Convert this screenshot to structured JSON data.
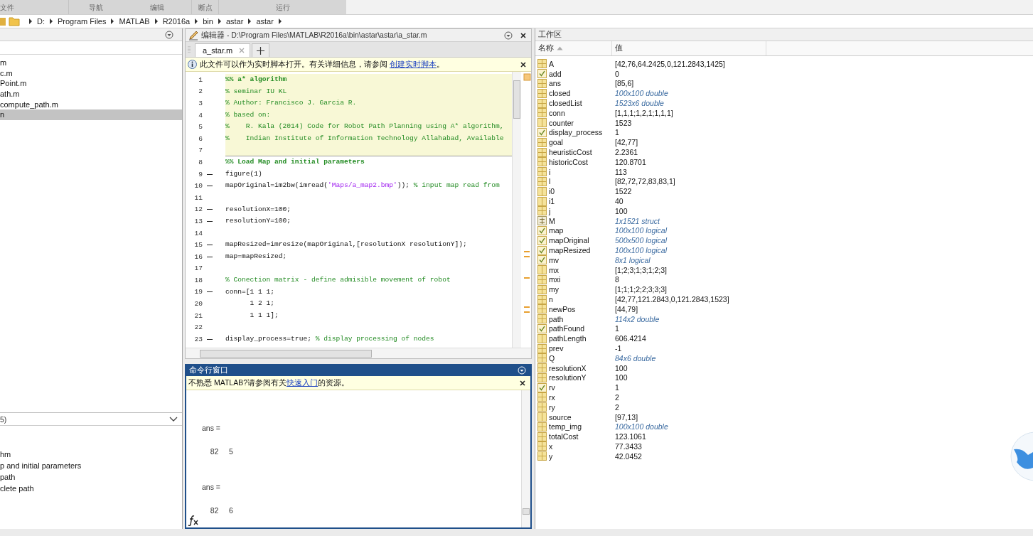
{
  "toolstrip": {
    "sections": [
      {
        "label": "文件"
      },
      {
        "label": "导航"
      },
      {
        "label": "编辑"
      },
      {
        "label": "断点"
      },
      {
        "label": "运行"
      }
    ]
  },
  "address_bar": {
    "segments": [
      "D:",
      "Program Files",
      "MATLAB",
      "R2016a",
      "bin",
      "astar",
      "astar"
    ]
  },
  "current_folder": {
    "files": [
      {
        "name": "m",
        "selected": false
      },
      {
        "name": "c.m",
        "selected": false
      },
      {
        "name": "Point.m",
        "selected": false
      },
      {
        "name": "ath.m",
        "selected": false
      },
      {
        "name": "compute_path.m",
        "selected": false
      },
      {
        "name": "n",
        "selected": true
      }
    ]
  },
  "details": {
    "header": "5)",
    "items": [
      "hm",
      "p and initial parameters",
      " path",
      "clete path"
    ]
  },
  "editor": {
    "title": "编辑器 - D:\\Program Files\\MATLAB\\R2016a\\bin\\astar\\astar\\a_star.m",
    "tabs": [
      {
        "label": "a_star.m",
        "selected": true
      }
    ],
    "info_bar": {
      "text": "此文件可以作为实时脚本打开。有关详细信息，请参阅 ",
      "link": "创建实时脚本",
      "end": "。"
    },
    "lines": [
      {
        "number": "1",
        "dash": false,
        "cell": true,
        "segments": [
          {
            "kind": "cell_title",
            "text": "%% a* algorithm"
          }
        ]
      },
      {
        "number": "2",
        "dash": false,
        "cell": true,
        "segments": [
          {
            "kind": "comment",
            "text": "% seminar IU KL"
          }
        ]
      },
      {
        "number": "3",
        "dash": false,
        "cell": true,
        "segments": [
          {
            "kind": "comment",
            "text": "% Author: Francisco J. Garcia R."
          }
        ]
      },
      {
        "number": "4",
        "dash": false,
        "cell": true,
        "segments": [
          {
            "kind": "comment",
            "text": "% based on:"
          }
        ]
      },
      {
        "number": "5",
        "dash": false,
        "cell": true,
        "segments": [
          {
            "kind": "comment",
            "text": "%    R. Kala (2014) Code for Robot Path Planning using A* algorithm,"
          }
        ]
      },
      {
        "number": "6",
        "dash": false,
        "cell": true,
        "segments": [
          {
            "kind": "comment",
            "text": "%    Indian Institute of Information Technology Allahabad, Available"
          }
        ]
      },
      {
        "number": "7",
        "dash": false,
        "cell": true
      },
      {
        "number": "8",
        "dash": false,
        "cell": false,
        "segments": [
          {
            "kind": "cell_title",
            "text": "%% Load Map and initial parameters"
          }
        ]
      },
      {
        "number": "9",
        "dash": true,
        "cell": false,
        "segments": [
          {
            "kind": "code",
            "text": "figure(1)"
          }
        ]
      },
      {
        "number": "10",
        "dash": true,
        "cell": false,
        "segments": [
          {
            "kind": "code",
            "text": "mapOriginal=im2bw(imread("
          },
          {
            "kind": "string",
            "text": "'Maps/a_map2.bmp'"
          },
          {
            "kind": "code",
            "text": ")); "
          },
          {
            "kind": "comment",
            "text": "% input map read from"
          }
        ]
      },
      {
        "number": "11",
        "dash": false,
        "cell": false
      },
      {
        "number": "12",
        "dash": true,
        "cell": false,
        "segments": [
          {
            "kind": "code",
            "text": "resolutionX=100;"
          }
        ]
      },
      {
        "number": "13",
        "dash": true,
        "cell": false,
        "segments": [
          {
            "kind": "code",
            "text": "resolutionY=100;"
          }
        ]
      },
      {
        "number": "14",
        "dash": false,
        "cell": false
      },
      {
        "number": "15",
        "dash": true,
        "cell": false,
        "segments": [
          {
            "kind": "code",
            "text": "mapResized=imresize(mapOriginal,[resolutionX resolutionY]);"
          }
        ]
      },
      {
        "number": "16",
        "dash": true,
        "cell": false,
        "segments": [
          {
            "kind": "code",
            "text": "map=mapResized;"
          }
        ]
      },
      {
        "number": "17",
        "dash": false,
        "cell": false
      },
      {
        "number": "18",
        "dash": false,
        "cell": false,
        "segments": [
          {
            "kind": "comment",
            "text": "% Conection matrix - define admisible movement of robot"
          }
        ]
      },
      {
        "number": "19",
        "dash": true,
        "cell": false,
        "segments": [
          {
            "kind": "code",
            "text": "conn=[1 1 1;"
          }
        ]
      },
      {
        "number": "20",
        "dash": false,
        "cell": false,
        "segments": [
          {
            "kind": "code",
            "text": "      1 2 1;"
          }
        ]
      },
      {
        "number": "21",
        "dash": false,
        "cell": false,
        "segments": [
          {
            "kind": "code",
            "text": "      1 1 1];"
          }
        ]
      },
      {
        "number": "22",
        "dash": false,
        "cell": false
      },
      {
        "number": "23",
        "dash": true,
        "cell": false,
        "segments": [
          {
            "kind": "code",
            "text": "display_process=true; "
          },
          {
            "kind": "comment",
            "text": "% display processing of nodes"
          }
        ]
      }
    ]
  },
  "command_window": {
    "title": "命令行窗口",
    "info_bar": {
      "text": "不熟悉 MATLAB?请参阅有关",
      "link": "快速入门",
      "end": "的资源。"
    },
    "output": [
      {
        "kind": "label",
        "text": "ans ="
      },
      {
        "kind": "value",
        "text": "    82     5"
      },
      {
        "kind": "label",
        "text": "ans ="
      },
      {
        "kind": "value",
        "text": "    82     6"
      }
    ]
  },
  "workspace": {
    "title": "工作区",
    "columns": [
      {
        "label": "名称",
        "sorted": true
      },
      {
        "label": "值",
        "sorted": false
      }
    ],
    "variables": [
      {
        "name": "A",
        "kind": "matrix",
        "value": "[42,76,64.2425,0,121.2843,1425]",
        "summary": false
      },
      {
        "name": "add",
        "kind": "logical",
        "value": "0",
        "summary": false
      },
      {
        "name": "ans",
        "kind": "matrix",
        "value": "[85,6]",
        "summary": false
      },
      {
        "name": "closed",
        "kind": "matrix",
        "value": "100x100 double",
        "summary": true
      },
      {
        "name": "closedList",
        "kind": "matrix",
        "value": "1523x6 double",
        "summary": true
      },
      {
        "name": "conn",
        "kind": "matrix",
        "value": "[1,1,1;1,2,1;1,1,1]",
        "summary": false
      },
      {
        "name": "counter",
        "kind": "scalar",
        "value": "1523",
        "summary": false
      },
      {
        "name": "display_process",
        "kind": "logical",
        "value": "1",
        "summary": false
      },
      {
        "name": "goal",
        "kind": "matrix",
        "value": "[42,77]",
        "summary": false
      },
      {
        "name": "heuristicCost",
        "kind": "matrix",
        "value": "2.2361",
        "summary": false
      },
      {
        "name": "historicCost",
        "kind": "matrix",
        "value": "120.8701",
        "summary": false
      },
      {
        "name": "i",
        "kind": "matrix",
        "value": "113",
        "summary": false
      },
      {
        "name": "l",
        "kind": "matrix",
        "value": "[82,72,72,83,83,1]",
        "summary": false
      },
      {
        "name": "i0",
        "kind": "scalar",
        "value": "1522",
        "summary": false
      },
      {
        "name": "i1",
        "kind": "scalar",
        "value": "40",
        "summary": false
      },
      {
        "name": "j",
        "kind": "matrix",
        "value": "100",
        "summary": false
      },
      {
        "name": "M",
        "kind": "struct",
        "value": "1x1521 struct",
        "summary": true
      },
      {
        "name": "map",
        "kind": "logical",
        "value": "100x100 logical",
        "summary": true
      },
      {
        "name": "mapOriginal",
        "kind": "logical",
        "value": "500x500 logical",
        "summary": true
      },
      {
        "name": "mapResized",
        "kind": "logical",
        "value": "100x100 logical",
        "summary": true
      },
      {
        "name": "mv",
        "kind": "logical",
        "value": "8x1 logical",
        "summary": true
      },
      {
        "name": "mx",
        "kind": "scalar",
        "value": "[1;2;3;1;3;1;2;3]",
        "summary": false
      },
      {
        "name": "mxi",
        "kind": "matrix",
        "value": "8",
        "summary": false
      },
      {
        "name": "my",
        "kind": "matrix",
        "value": "[1;1;1;2;2;3;3;3]",
        "summary": false
      },
      {
        "name": "n",
        "kind": "matrix",
        "value": "[42,77,121.2843,0,121.2843,1523]",
        "summary": false
      },
      {
        "name": "newPos",
        "kind": "matrix",
        "value": "[44,79]",
        "summary": false
      },
      {
        "name": "path",
        "kind": "matrix",
        "value": "114x2 double",
        "summary": true
      },
      {
        "name": "pathFound",
        "kind": "logical",
        "value": "1",
        "summary": false
      },
      {
        "name": "pathLength",
        "kind": "scalar",
        "value": "606.4214",
        "summary": false
      },
      {
        "name": "prev",
        "kind": "matrix",
        "value": "-1",
        "summary": false
      },
      {
        "name": "Q",
        "kind": "matrix",
        "value": "84x6 double",
        "summary": true
      },
      {
        "name": "resolutionX",
        "kind": "matrix",
        "value": "100",
        "summary": false
      },
      {
        "name": "resolutionY",
        "kind": "matrix",
        "value": "100",
        "summary": false
      },
      {
        "name": "rv",
        "kind": "logical",
        "value": "1",
        "summary": false
      },
      {
        "name": "rx",
        "kind": "matrix",
        "value": "2",
        "summary": false
      },
      {
        "name": "ry",
        "kind": "matrix",
        "value": "2",
        "summary": false
      },
      {
        "name": "source",
        "kind": "scalar",
        "value": "[97,13]",
        "summary": false
      },
      {
        "name": "temp_img",
        "kind": "matrix",
        "value": "100x100 double",
        "summary": true
      },
      {
        "name": "totalCost",
        "kind": "matrix",
        "value": "123.1061",
        "summary": false
      },
      {
        "name": "x",
        "kind": "matrix",
        "value": "77.3433",
        "summary": false
      },
      {
        "name": "y",
        "kind": "matrix",
        "value": "42.0452",
        "summary": false
      }
    ]
  }
}
